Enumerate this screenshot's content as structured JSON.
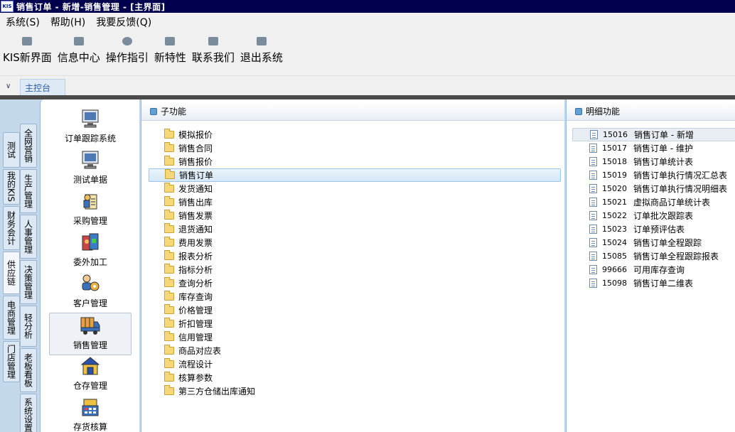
{
  "titlebar": {
    "logo": "KIS",
    "title": "销售订单 - 新增-销售管理 - [主界面]"
  },
  "menu": [
    {
      "label": "系统(S)"
    },
    {
      "label": "帮助(H)"
    },
    {
      "label": "我要反馈(Q)"
    }
  ],
  "toolbar": [
    {
      "label": "KIS新界面",
      "icon": "layout-icon"
    },
    {
      "label": "信息中心",
      "icon": "mail-icon"
    },
    {
      "label": "操作指引",
      "icon": "compass-icon"
    },
    {
      "label": "新特性",
      "icon": "star-box-icon"
    },
    {
      "label": "联系我们",
      "icon": "chat-icon"
    },
    {
      "label": "退出系统",
      "icon": "exit-icon"
    }
  ],
  "tabstrip": {
    "active_tab": "主控台"
  },
  "outer_tabs": [
    "测试",
    "我的KIS",
    "财务会计",
    "供应链",
    "电商管理",
    "门店管理"
  ],
  "inner_tabs": [
    "全网营销",
    "生产管理",
    "人事管理",
    "决策管理",
    "轻分析",
    "老板看板",
    "系统设置"
  ],
  "modules": [
    {
      "label": "订单跟踪系统",
      "icon": "monitor-icon"
    },
    {
      "label": "测试单据",
      "icon": "monitor-icon"
    },
    {
      "label": "采购管理",
      "icon": "purchase-icon"
    },
    {
      "label": "委外加工",
      "icon": "outsourcing-icon"
    },
    {
      "label": "客户管理",
      "icon": "customer-icon"
    },
    {
      "label": "销售管理",
      "icon": "truck-icon"
    },
    {
      "label": "仓存管理",
      "icon": "warehouse-icon"
    },
    {
      "label": "存货核算",
      "icon": "calculator-icon"
    }
  ],
  "subpanel": {
    "header": "子功能",
    "items": [
      "模拟报价",
      "销售合同",
      "销售报价",
      "销售订单",
      "发货通知",
      "销售出库",
      "销售发票",
      "退货通知",
      "费用发票",
      "报表分析",
      "指标分析",
      "查询分析",
      "库存查询",
      "价格管理",
      "折扣管理",
      "信用管理",
      "商品对应表",
      "流程设计",
      "核算参数",
      "第三方仓储出库通知"
    ]
  },
  "detailpanel": {
    "header": "明细功能",
    "items": [
      {
        "code": "15016",
        "label": "销售订单 - 新增"
      },
      {
        "code": "15017",
        "label": "销售订单 - 维护"
      },
      {
        "code": "15018",
        "label": "销售订单统计表"
      },
      {
        "code": "15019",
        "label": "销售订单执行情况汇总表"
      },
      {
        "code": "15020",
        "label": "销售订单执行情况明细表"
      },
      {
        "code": "15021",
        "label": "虚拟商品订单统计表"
      },
      {
        "code": "15022",
        "label": "订单批次跟踪表"
      },
      {
        "code": "15023",
        "label": "订单预评估表"
      },
      {
        "code": "15024",
        "label": "销售订单全程跟踪"
      },
      {
        "code": "15085",
        "label": "销售订单全程跟踪报表"
      },
      {
        "code": "99666",
        "label": "可用库存查询"
      },
      {
        "code": "15098",
        "label": "销售订单二维表"
      }
    ]
  },
  "colors": {
    "titlebar": "#00004e",
    "main_bg": "#c4d8ec",
    "accent": "#2a5ea8"
  }
}
